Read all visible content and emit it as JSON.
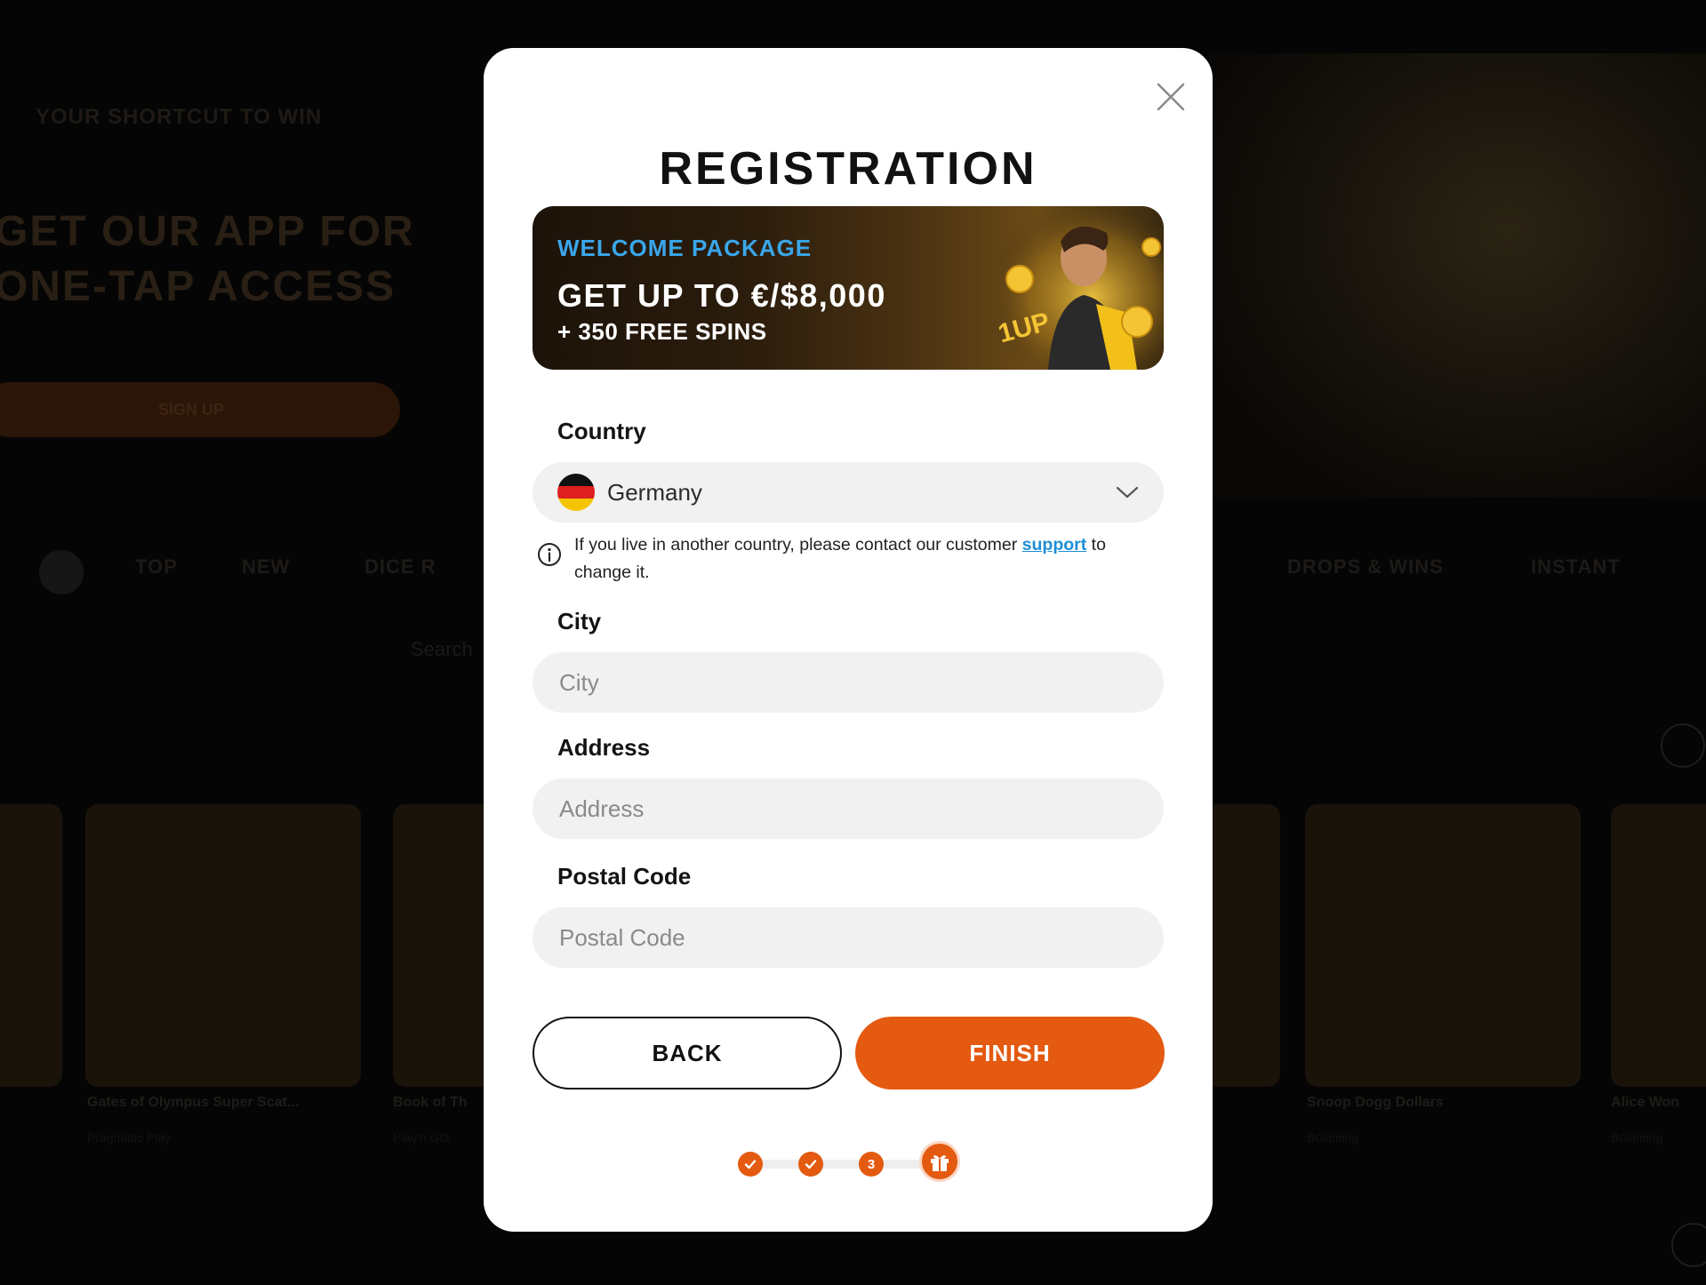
{
  "background": {
    "top_link": "YOUR SHORTCUT TO WIN",
    "hero_title_line1": "GET OUR APP FOR",
    "hero_title_line2": "ONE-TAP ACCESS",
    "hero_button": "SIGN UP",
    "nav": [
      "TOP",
      "NEW",
      "DICE R",
      "DROPS & WINS",
      "INSTANT"
    ],
    "search_placeholder": "Search",
    "cards": [
      {
        "caption": "Gates of Olympus Super Scat...",
        "sub": "Pragmatic Play"
      },
      {
        "caption": "Book of Th",
        "sub": "Play'n GO"
      },
      {
        "caption": "Snoop Dogg Dollars",
        "sub": "BGaming"
      },
      {
        "caption": "Alice Won",
        "sub": "BGaming"
      }
    ]
  },
  "modal": {
    "title": "REGISTRATION",
    "promo": {
      "kicker": "WELCOME PACKAGE",
      "title": "GET UP TO €/$8,000",
      "subtitle": "+ 350 FREE SPINS",
      "accent_color": "#3aa6ea"
    },
    "country": {
      "label": "Country",
      "value": "Germany",
      "flag": "germany-flag-icon"
    },
    "info": {
      "text_before": "If you live in another country, please contact our customer ",
      "link": "support",
      "text_after": " to change it."
    },
    "city": {
      "label": "City",
      "placeholder": "City",
      "value": ""
    },
    "address": {
      "label": "Address",
      "placeholder": "Address",
      "value": ""
    },
    "postal": {
      "label": "Postal Code",
      "placeholder": "Postal Code",
      "value": ""
    },
    "buttons": {
      "back": "BACK",
      "finish": "FINISH"
    },
    "steps": {
      "current": "3",
      "total_steps": 4,
      "colors": {
        "primary": "#e35a10"
      }
    }
  }
}
